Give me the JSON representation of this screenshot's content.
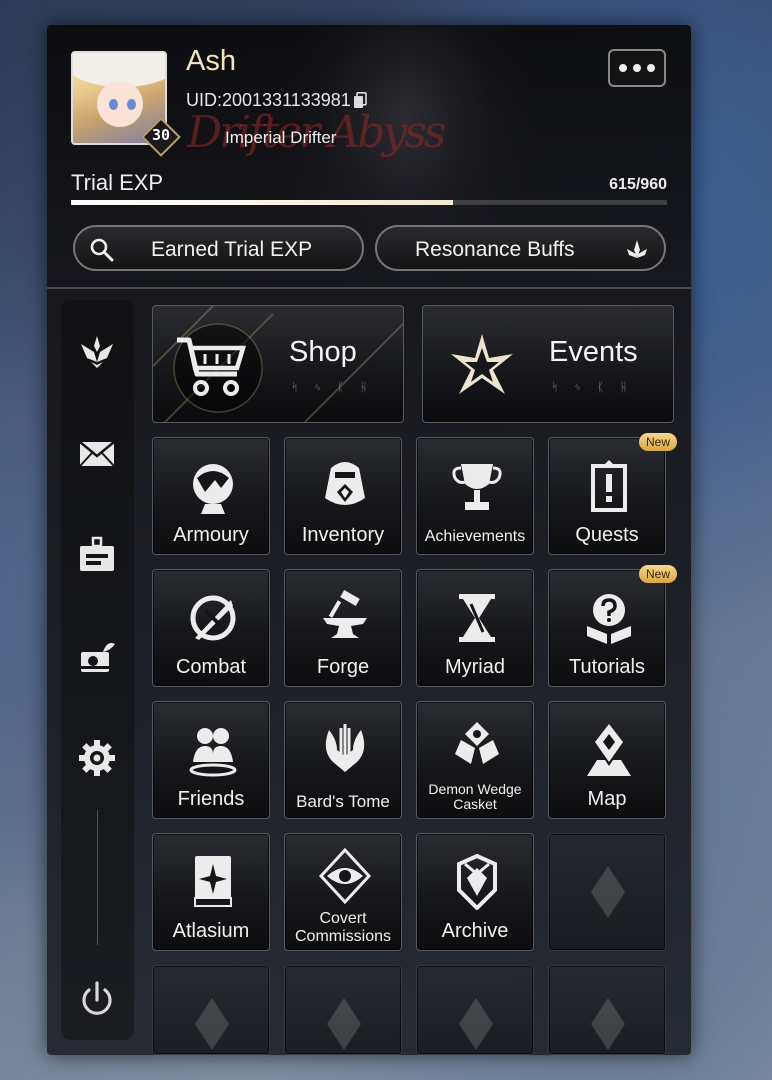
{
  "profile": {
    "name": "Ash",
    "uid": "UID:2001331133981",
    "level": "30",
    "title": "Imperial Drifter",
    "signature_deco": "Drifter Abyss"
  },
  "exp": {
    "label": "Trial EXP",
    "value": "615/960",
    "current": 615,
    "max": 960
  },
  "buttons": {
    "earned": "Earned Trial EXP",
    "resonance": "Resonance Buffs"
  },
  "features": [
    {
      "label": "Shop",
      "runes": "ᛋ ᛃ ᛕ ᚺ"
    },
    {
      "label": "Events",
      "runes": "ᛋ ᛃ ᛕ ᚺ"
    }
  ],
  "menu": [
    {
      "label": "Armoury"
    },
    {
      "label": "Inventory"
    },
    {
      "label": "Achievements"
    },
    {
      "label": "Quests",
      "badge": "New"
    },
    {
      "label": "Combat"
    },
    {
      "label": "Forge"
    },
    {
      "label": "Myriad"
    },
    {
      "label": "Tutorials",
      "badge": "New"
    },
    {
      "label": "Friends"
    },
    {
      "label": "Bard's Tome"
    },
    {
      "label_line1": "Demon Wedge",
      "label_line2": "Casket"
    },
    {
      "label": "Map"
    },
    {
      "label": "Atlasium"
    },
    {
      "label_line1": "Covert",
      "label_line2": "Commissions"
    },
    {
      "label": "Archive"
    }
  ],
  "sidebar_icons": [
    "emblem-icon",
    "mail-icon",
    "id-card-icon",
    "camera-icon",
    "gear-icon",
    "power-icon"
  ],
  "colors": {
    "accent_gold": "#f2e3b8",
    "badge": "#f0c569",
    "exp_fill": "#ffffff"
  }
}
